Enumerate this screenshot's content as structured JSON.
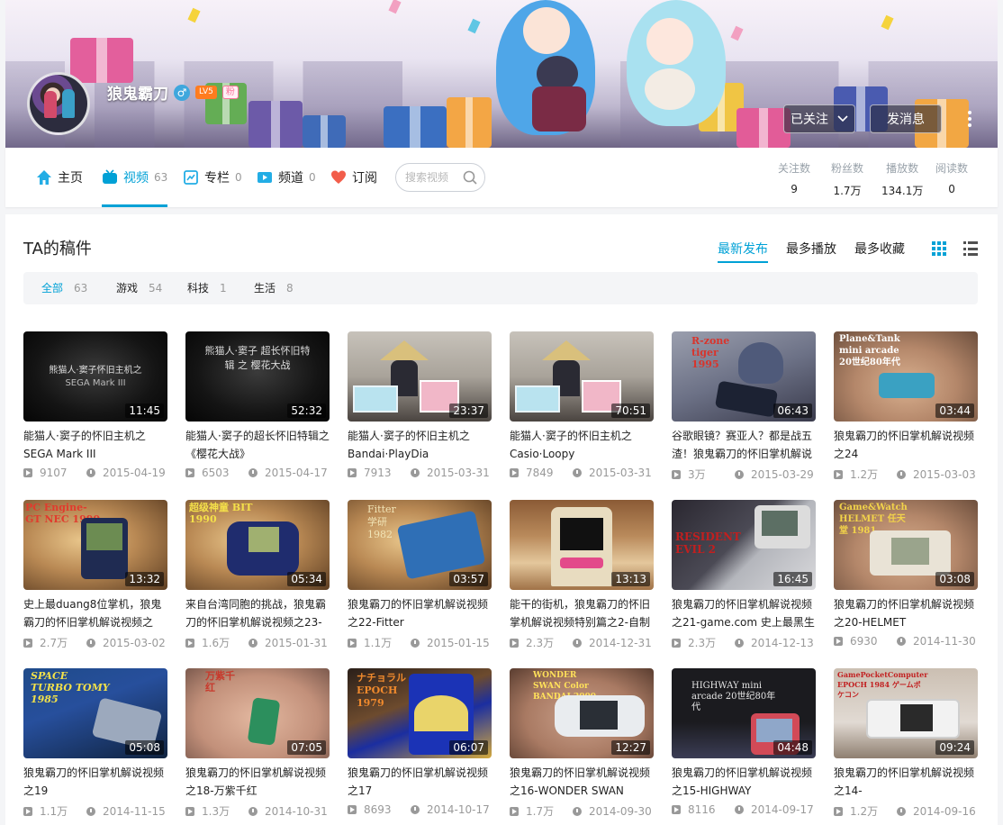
{
  "profile": {
    "username": "狼鬼霸刀",
    "gender_symbol": "♂",
    "level": "LV5",
    "fan_badge": "粉",
    "followed_label": "已关注",
    "message_label": "发消息"
  },
  "nav": {
    "home": "主页",
    "videos": "视频",
    "videos_count": "63",
    "articles": "专栏",
    "articles_count": "0",
    "channels": "频道",
    "channels_count": "0",
    "subscribe": "订阅",
    "search_placeholder": "搜索视频"
  },
  "stats": [
    {
      "label": "关注数",
      "value": "9"
    },
    {
      "label": "粉丝数",
      "value": "1.7万"
    },
    {
      "label": "播放数",
      "value": "134.1万"
    },
    {
      "label": "阅读数",
      "value": "0"
    }
  ],
  "section": {
    "title": "TA的稿件",
    "sort_latest": "最新发布",
    "sort_most_played": "最多播放",
    "sort_most_favorited": "最多收藏"
  },
  "filters": [
    {
      "label": "全部",
      "count": "63"
    },
    {
      "label": "游戏",
      "count": "54"
    },
    {
      "label": "科技",
      "count": "1"
    },
    {
      "label": "生活",
      "count": "8"
    }
  ],
  "videos": [
    {
      "title": "能猫人·窦子的怀旧主机之SEGA Mark III",
      "duration": "11:45",
      "plays": "9107",
      "date": "2015-04-19",
      "thumb_text": "熊猫人·窦子怀旧主机之"
    },
    {
      "title": "能猫人·窦子的超长怀旧特辑之《樱花大战》",
      "duration": "52:32",
      "plays": "6503",
      "date": "2015-04-17",
      "thumb_text": "熊猫人·窦子 超长怀旧特辑 之 樱花大战"
    },
    {
      "title": "能猫人·窦子的怀旧主机之Bandai·PlayDia",
      "duration": "23:37",
      "plays": "7913",
      "date": "2015-03-31"
    },
    {
      "title": "能猫人·窦子的怀旧主机之Casio·Loopy",
      "duration": "70:51",
      "plays": "7849",
      "date": "2015-03-31"
    },
    {
      "title": "谷歌眼镜？赛亚人？都是战五渣！狼鬼霸刀的怀旧掌机解说",
      "duration": "06:43",
      "plays": "3万",
      "date": "2015-03-29",
      "thumb_text": "R-zone tiger 1995"
    },
    {
      "title": "狼鬼霸刀的怀旧掌机解说视频之24",
      "duration": "03:44",
      "plays": "1.2万",
      "date": "2015-03-03",
      "thumb_text": "Plane&Tank mini arcade 20世纪80年代"
    },
    {
      "title": "史上最duang8位掌机，狼鬼霸刀的怀旧掌机解说视频之",
      "duration": "13:32",
      "plays": "2.7万",
      "date": "2015-03-02",
      "thumb_text": "PC Engine- GT NEC 1990"
    },
    {
      "title": "来自台湾同胞的挑战，狼鬼霸刀的怀旧掌机解说视频之23-",
      "duration": "05:34",
      "plays": "1.6万",
      "date": "2015-01-31",
      "thumb_text": "超级神童 BIT 1990"
    },
    {
      "title": "狼鬼霸刀的怀旧掌机解说视频之22-Fitter",
      "duration": "03:57",
      "plays": "1.1万",
      "date": "2015-01-15",
      "thumb_text": "Fitter 学研 1982"
    },
    {
      "title": "能干的街机，狼鬼霸刀的怀旧掌机解说视频特别篇之2-自制",
      "duration": "13:13",
      "plays": "2.3万",
      "date": "2014-12-31"
    },
    {
      "title": "狼鬼霸刀的怀旧掌机解说视频之21-game.com 史上最黑生",
      "duration": "16:45",
      "plays": "2.3万",
      "date": "2014-12-13",
      "thumb_text": "RESIDENT EVIL 2"
    },
    {
      "title": "狼鬼霸刀的怀旧掌机解说视频之20-HELMET",
      "duration": "03:08",
      "plays": "6930",
      "date": "2014-11-30",
      "thumb_text": "Game&Watch HELMET 任天堂 1981"
    },
    {
      "title": "狼鬼霸刀的怀旧掌机解说视频之19",
      "duration": "05:08",
      "plays": "1.1万",
      "date": "2014-11-15",
      "thumb_text": "SPACE TURBO TOMY 1985"
    },
    {
      "title": "狼鬼霸刀的怀旧掌机解说视频之18-万紫千红",
      "duration": "07:05",
      "plays": "1.3万",
      "date": "2014-10-31",
      "thumb_text": "万紫千红"
    },
    {
      "title": "狼鬼霸刀的怀旧掌机解说视频之17",
      "duration": "06:07",
      "plays": "8693",
      "date": "2014-10-17",
      "thumb_text": "ナチョラル EPOCH 1979"
    },
    {
      "title": "狼鬼霸刀的怀旧掌机解说视频之16-WONDER SWAN",
      "duration": "12:27",
      "plays": "1.7万",
      "date": "2014-09-30",
      "thumb_text": "WONDER SWAN Color BANDAI 2000"
    },
    {
      "title": "狼鬼霸刀的怀旧掌机解说视频之15-HIGHWAY",
      "duration": "04:48",
      "plays": "8116",
      "date": "2014-09-17",
      "thumb_text": "HIGHWAY mini arcade 20世纪80年代"
    },
    {
      "title": "狼鬼霸刀的怀旧掌机解说视频之14-",
      "duration": "09:24",
      "plays": "1.2万",
      "date": "2014-09-16",
      "thumb_text": "GamePocketComputer EPOCH 1984 ゲームポケコン"
    }
  ],
  "colors": {
    "accent": "#00a1d6",
    "pink": "#fb7299",
    "level": "#ff7c1f"
  }
}
